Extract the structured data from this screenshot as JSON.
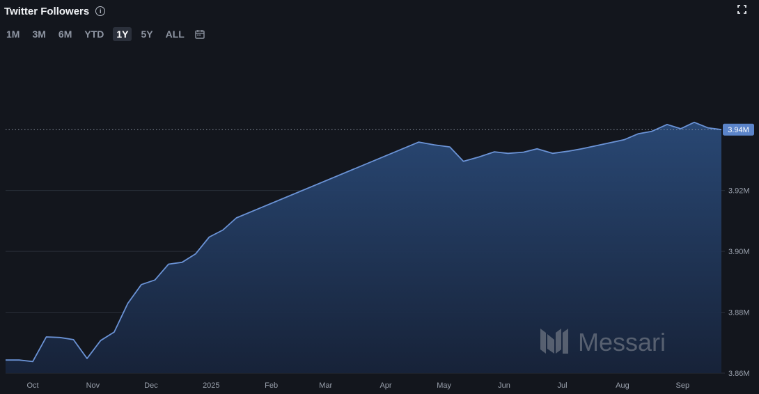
{
  "header": {
    "title": "Twitter Followers",
    "info_icon": "info-icon",
    "expand_icon": "expand-icon"
  },
  "range_buttons": [
    "1M",
    "3M",
    "6M",
    "YTD",
    "1Y",
    "5Y",
    "ALL"
  ],
  "active_range": "1Y",
  "calendar_icon": "calendar-icon",
  "watermark": "Messari",
  "colors": {
    "background": "#13161d",
    "line": "#6b93d6",
    "area_top": "#2a4a78",
    "area_bottom": "#17233a",
    "badge": "#5b84c9"
  },
  "chart_data": {
    "type": "area",
    "title": "Twitter Followers",
    "xlabel": "",
    "ylabel": "",
    "x_tick_labels": [
      "Oct",
      "Nov",
      "Dec",
      "2025",
      "Feb",
      "Mar",
      "Apr",
      "May",
      "Jun",
      "Jul",
      "Aug",
      "Sep"
    ],
    "y_tick_labels": [
      "3.86M",
      "3.88M",
      "3.90M",
      "3.92M",
      "3.94M"
    ],
    "ylim": [
      3.86,
      3.962
    ],
    "y_unit": "M",
    "current_value_label": "3.94M",
    "grid": true,
    "series": [
      {
        "x": [
          "2024-09-17",
          "2024-09-24",
          "2024-10-01",
          "2024-10-08",
          "2024-10-15",
          "2024-10-22",
          "2024-10-29",
          "2024-11-05",
          "2024-11-12",
          "2024-11-19",
          "2024-11-26",
          "2024-12-03",
          "2024-12-10",
          "2024-12-17",
          "2024-12-24",
          "2024-12-31",
          "2025-01-07",
          "2025-01-14",
          "2025-04-18",
          "2025-04-26",
          "2025-05-04",
          "2025-05-11",
          "2025-05-19",
          "2025-05-27",
          "2025-06-03",
          "2025-06-11",
          "2025-06-18",
          "2025-06-26",
          "2025-07-04",
          "2025-07-11",
          "2025-08-02",
          "2025-08-09",
          "2025-08-16",
          "2025-08-24",
          "2025-08-31",
          "2025-09-07",
          "2025-09-14",
          "2025-09-21"
        ],
        "y": [
          3.8643,
          3.8643,
          3.8638,
          3.8719,
          3.8717,
          3.871,
          3.8648,
          3.8707,
          3.8735,
          3.8829,
          3.8891,
          3.8906,
          3.8958,
          3.8964,
          3.8992,
          3.9047,
          3.907,
          3.911,
          3.9359,
          3.935,
          3.9343,
          3.9296,
          3.931,
          3.9327,
          3.9322,
          3.9326,
          3.9337,
          3.9322,
          3.9329,
          3.9337,
          3.9367,
          3.9386,
          3.9394,
          3.9417,
          3.9403,
          3.9424,
          3.9406,
          3.94
        ]
      }
    ]
  }
}
